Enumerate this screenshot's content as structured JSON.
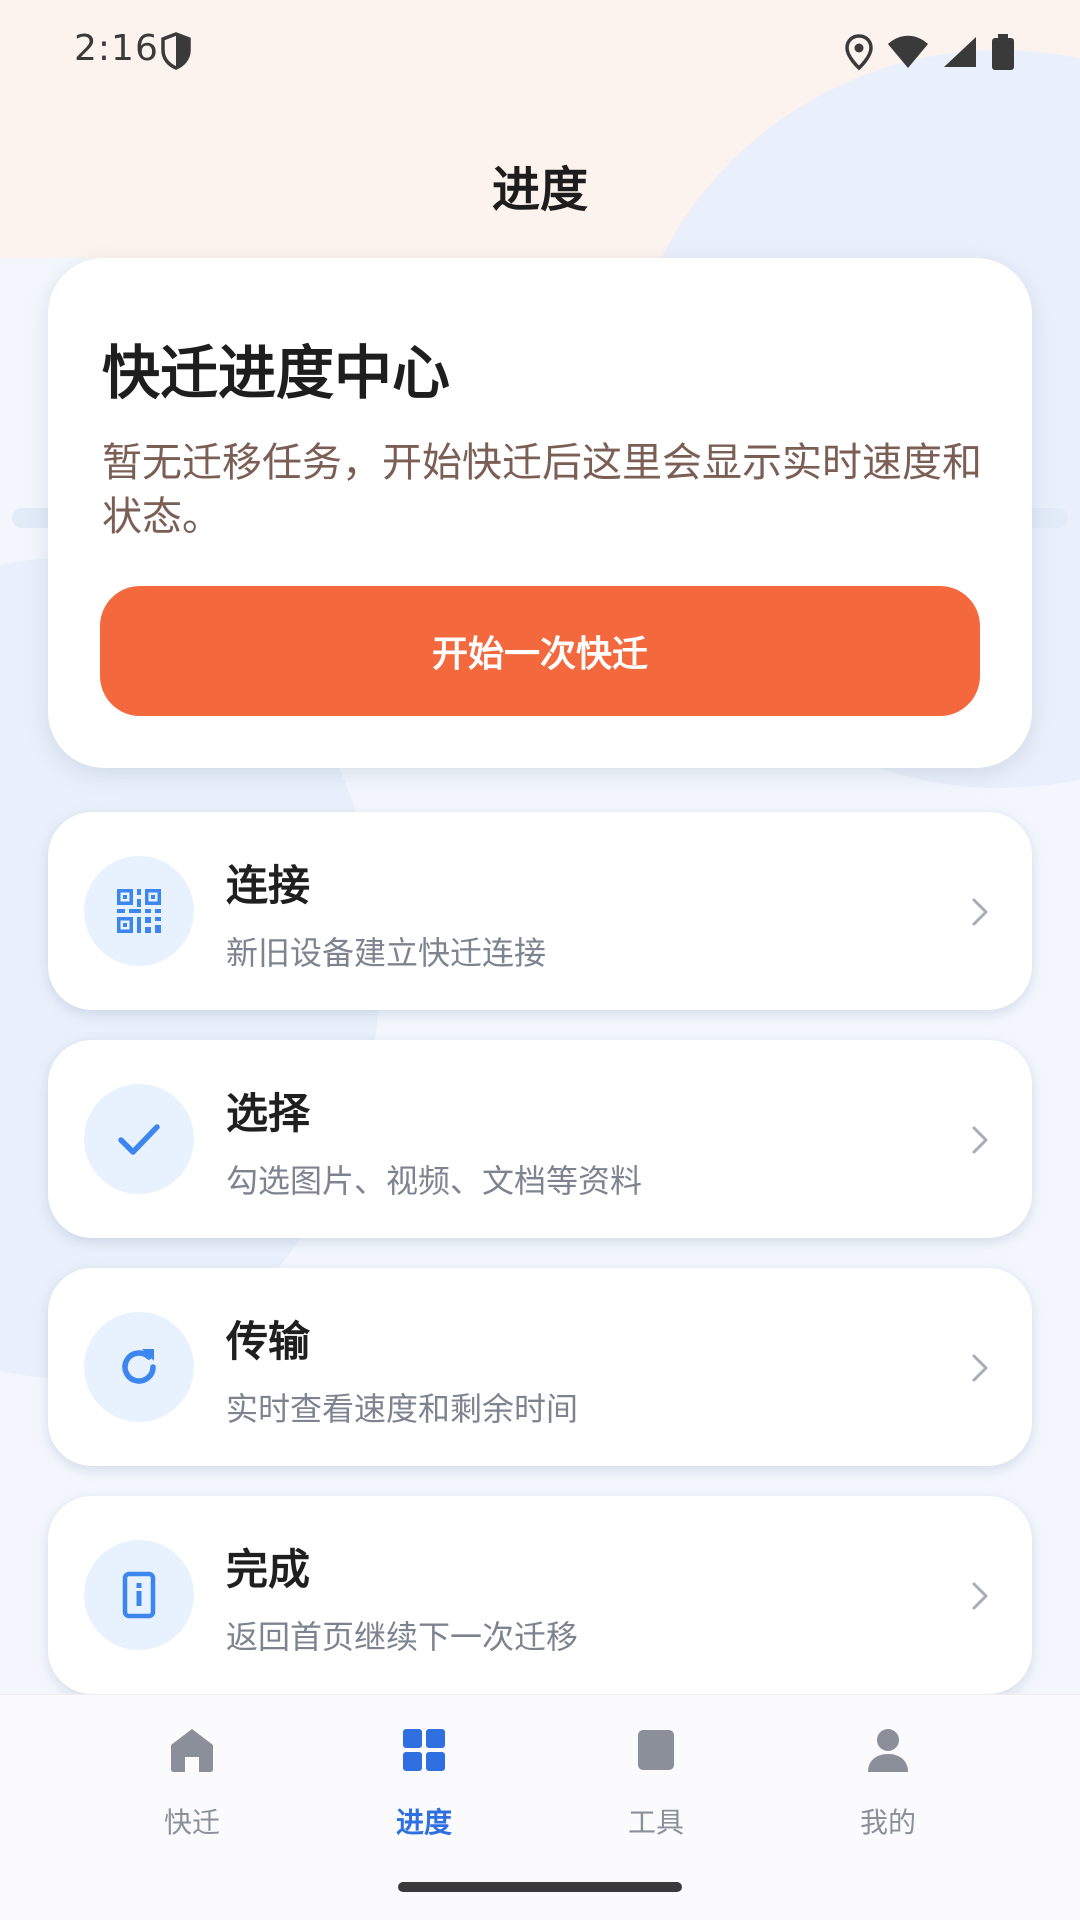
{
  "status_bar": {
    "time": "2:16"
  },
  "header": {
    "title": "进度"
  },
  "hero": {
    "title": "快迁进度中心",
    "description": "暂无迁移任务，开始快迁后这里会显示实时速度和状态。",
    "button_label": "开始一次快迁"
  },
  "steps": [
    {
      "title": "连接",
      "subtitle": "新旧设备建立快迁连接",
      "icon": "qr-code-icon"
    },
    {
      "title": "选择",
      "subtitle": "勾选图片、视频、文档等资料",
      "icon": "check-icon"
    },
    {
      "title": "传输",
      "subtitle": "实时查看速度和剩余时间",
      "icon": "refresh-icon"
    },
    {
      "title": "完成",
      "subtitle": "返回首页继续下一次迁移",
      "icon": "phone-info-icon"
    }
  ],
  "bottom_nav": {
    "items": [
      {
        "label": "快迁",
        "icon": "home-icon",
        "active": false
      },
      {
        "label": "进度",
        "icon": "grid-icon",
        "active": true
      },
      {
        "label": "工具",
        "icon": "tools-icon",
        "active": false
      },
      {
        "label": "我的",
        "icon": "user-icon",
        "active": false
      }
    ]
  },
  "colors": {
    "accent": "#f4683e",
    "active_nav": "#2f6fe0",
    "icon_blue": "#3d86ef",
    "icon_bg": "#e8f2fe"
  }
}
